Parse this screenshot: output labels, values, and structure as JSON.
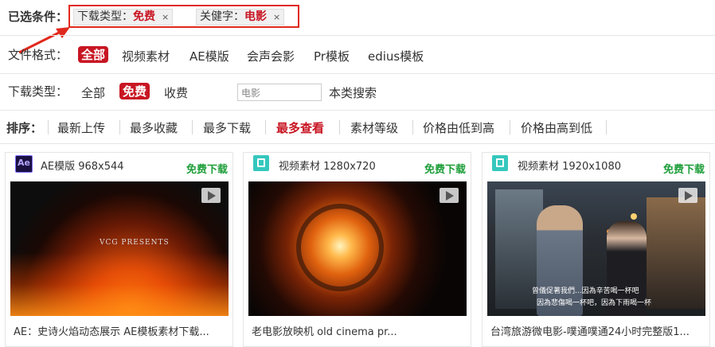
{
  "selected": {
    "label": "已选条件：",
    "chips": [
      {
        "key": "下载类型：",
        "value": "免费",
        "remove": "×"
      },
      {
        "key": "关健字：",
        "value": "电影",
        "remove": "×"
      }
    ]
  },
  "format_filter": {
    "label": "文件格式：",
    "options": [
      "全部",
      "视频素材",
      "AE模版",
      "会声会影",
      "Pr模板",
      "edius模板"
    ],
    "active": "全部"
  },
  "download_filter": {
    "label": "下载类型：",
    "options": [
      "全部",
      "免费",
      "收费"
    ],
    "active": "免费"
  },
  "search": {
    "value": "电影",
    "button": "本类搜索"
  },
  "sort": {
    "label": "排序：",
    "items": [
      "最新上传",
      "最多收藏",
      "最多下载",
      "最多查看",
      "素材等级",
      "价格由低到高",
      "价格由高到低"
    ],
    "active": "最多查看"
  },
  "cards": [
    {
      "type_label": "AE模版 968x544",
      "free_label": "免费下载",
      "title": "AE：史诗火焰动态展示 AE模板素材下载...",
      "icon": "ae-icon",
      "thumb_text": "VCG PRESENTS"
    },
    {
      "type_label": "视频素材 1280x720",
      "free_label": "免费下载",
      "title": "老电影放映机 old cinema pr...",
      "icon": "video-icon"
    },
    {
      "type_label": "视频素材 1920x1080",
      "free_label": "免费下载",
      "title": "台湾旅游微电影-噗通噗通24小时完整版1...",
      "icon": "video-icon",
      "subtitle_1": "曾儀促著我們...因為辛苦喝一杯吧",
      "subtitle_2": "因為悲傷喝一杯吧，因為下雨喝一杯"
    }
  ],
  "colors": {
    "accent": "#c81623",
    "free": "#1e9e3a",
    "highlight_box": "#e0291d"
  }
}
